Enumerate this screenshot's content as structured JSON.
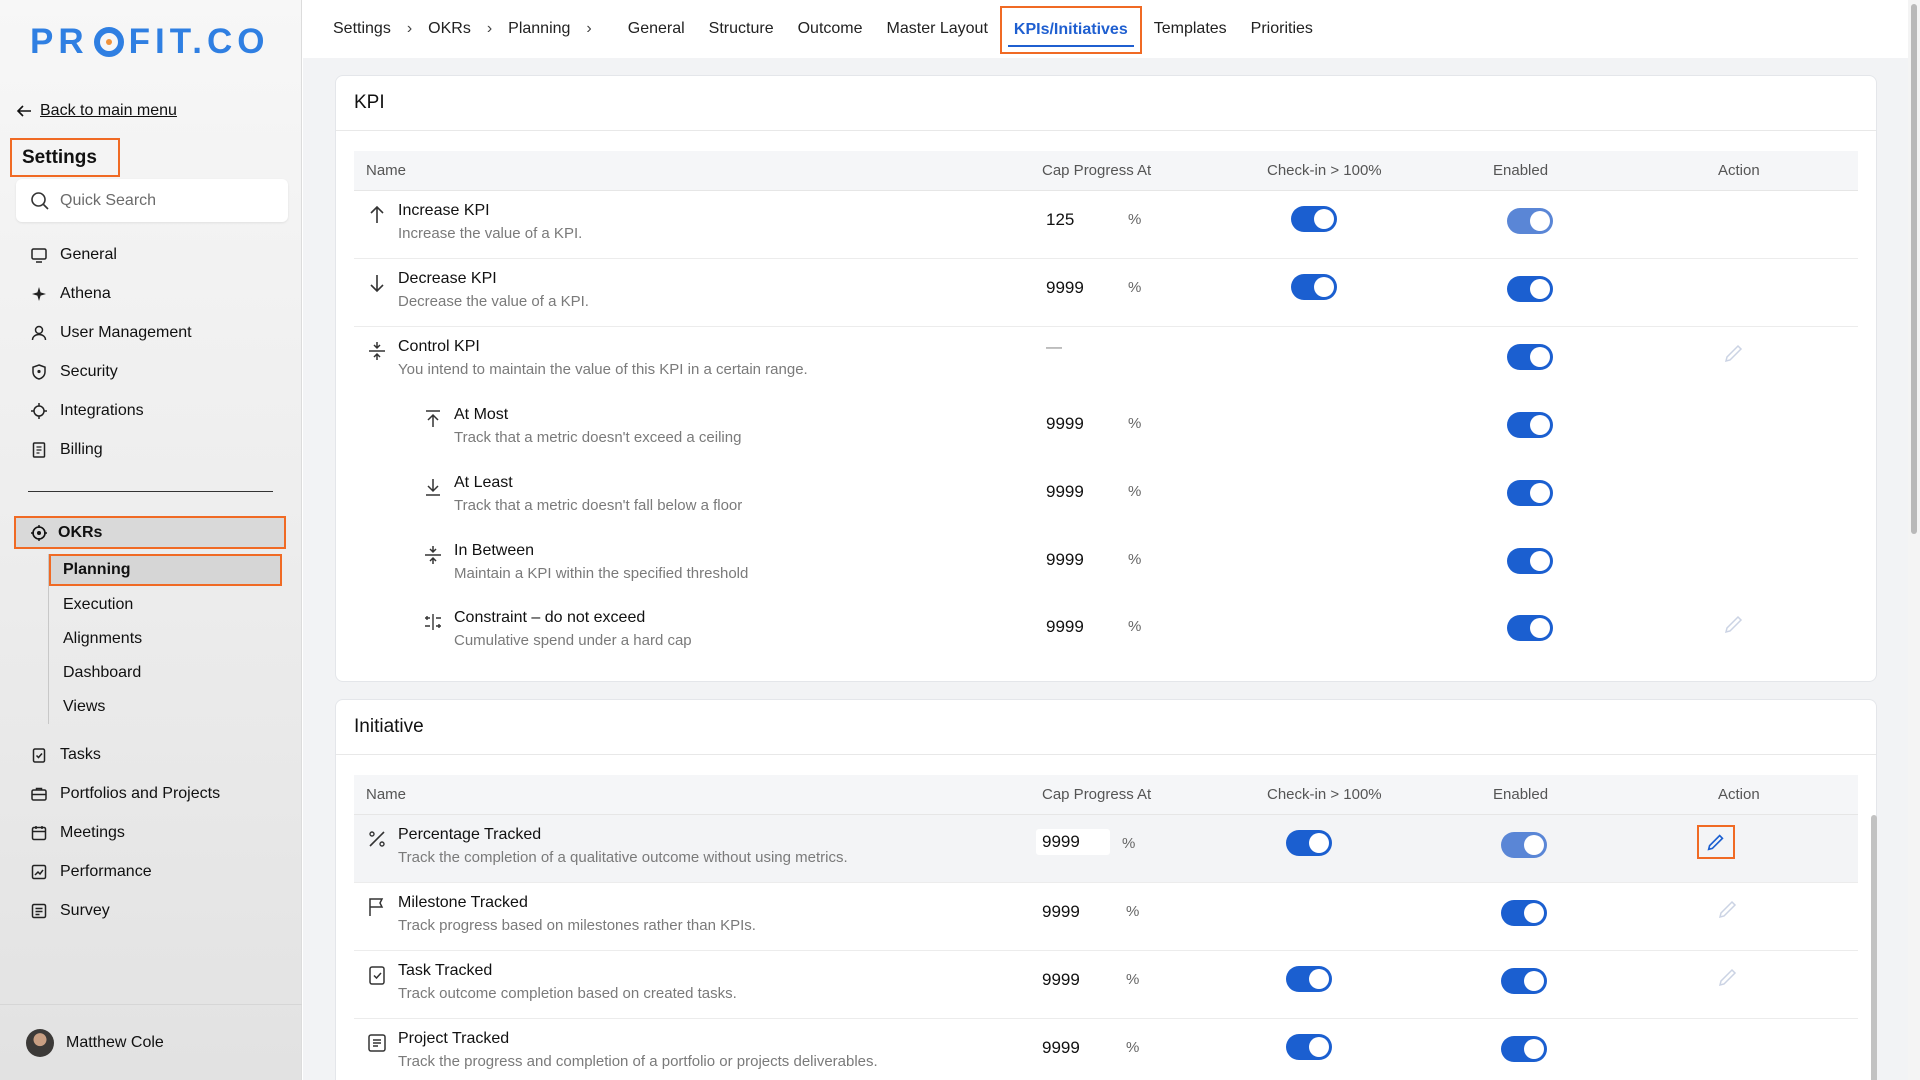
{
  "brand": {
    "pre": "PR",
    "post": "FIT.CO"
  },
  "sidebar": {
    "back_label": "Back to main menu",
    "title": "Settings",
    "search_placeholder": "Quick Search",
    "items": [
      {
        "label": "General",
        "icon": "monitor-icon"
      },
      {
        "label": "Athena",
        "icon": "sparkle-icon"
      },
      {
        "label": "User Management",
        "icon": "user-icon"
      },
      {
        "label": "Security",
        "icon": "shield-icon"
      },
      {
        "label": "Integrations",
        "icon": "chip-icon"
      },
      {
        "label": "Billing",
        "icon": "receipt-icon"
      }
    ],
    "okrs_label": "OKRs",
    "okrs_sub": [
      "Planning",
      "Execution",
      "Alignments",
      "Dashboard",
      "Views"
    ],
    "okrs_active": "Planning",
    "items2": [
      {
        "label": "Tasks",
        "icon": "clipboard-icon"
      },
      {
        "label": "Portfolios and Projects",
        "icon": "briefcase-icon"
      },
      {
        "label": "Meetings",
        "icon": "calendar-icon"
      },
      {
        "label": "Performance",
        "icon": "chart-icon"
      },
      {
        "label": "Survey",
        "icon": "survey-icon"
      }
    ],
    "user_name": "Matthew Cole"
  },
  "topbar": {
    "breadcrumb": [
      "Settings",
      "OKRs",
      "Planning"
    ],
    "separator": "›",
    "tabs": [
      "General",
      "Structure",
      "Outcome",
      "Master Layout",
      "KPIs/Initiatives",
      "Templates",
      "Priorities"
    ],
    "active_tab": "KPIs/Initiatives"
  },
  "kpi": {
    "title": "KPI",
    "headers": {
      "name": "Name",
      "cap": "Cap Progress At",
      "checkin": "Check-in > 100%",
      "enabled": "Enabled",
      "action": "Action"
    },
    "rows": [
      {
        "name": "Increase KPI",
        "desc": "Increase the value of a KPI.",
        "cap": "125",
        "pct": "%",
        "checkin": true,
        "enabled": true
      },
      {
        "name": "Decrease KPI",
        "desc": "Decrease the value of a KPI.",
        "cap": "9999",
        "pct": "%",
        "checkin": true,
        "enabled": true
      },
      {
        "name": "Control KPI",
        "desc": "You intend to maintain the value of this KPI in a certain range.",
        "cap": "—",
        "enabled": true
      },
      {
        "name": "At Most",
        "desc": "Track that a metric doesn't exceed a ceiling",
        "cap": "9999",
        "pct": "%",
        "enabled": true
      },
      {
        "name": "At Least",
        "desc": "Track that a metric doesn't fall below a floor",
        "cap": "9999",
        "pct": "%",
        "enabled": true
      },
      {
        "name": "In Between",
        "desc": "Maintain a KPI within the specified threshold",
        "cap": "9999",
        "pct": "%",
        "enabled": true
      },
      {
        "name": "Constraint – do not exceed",
        "desc": "Cumulative spend under a hard cap",
        "cap": "9999",
        "pct": "%",
        "enabled": true
      }
    ]
  },
  "initiative": {
    "title": "Initiative",
    "headers": {
      "name": "Name",
      "cap": "Cap Progress At",
      "checkin": "Check-in > 100%",
      "enabled": "Enabled",
      "action": "Action"
    },
    "rows": [
      {
        "name": "Percentage Tracked",
        "desc": "Track the completion of a qualitative outcome without using metrics.",
        "cap": "9999",
        "pct": "%",
        "checkin": true,
        "enabled": true
      },
      {
        "name": "Milestone Tracked",
        "desc": "Track progress based on milestones rather than KPIs.",
        "cap": "9999",
        "pct": "%",
        "enabled": true
      },
      {
        "name": "Task Tracked",
        "desc": "Track outcome completion based on created tasks.",
        "cap": "9999",
        "pct": "%",
        "checkin": true,
        "enabled": true
      },
      {
        "name": "Project Tracked",
        "desc": "Track the progress and completion of a portfolio or projects deliverables.",
        "cap": "9999",
        "pct": "%",
        "checkin": true,
        "enabled": true
      }
    ]
  },
  "colors": {
    "accent": "#1b5fd0",
    "highlight": "#f06a24",
    "brand": "#2f7fe2"
  }
}
